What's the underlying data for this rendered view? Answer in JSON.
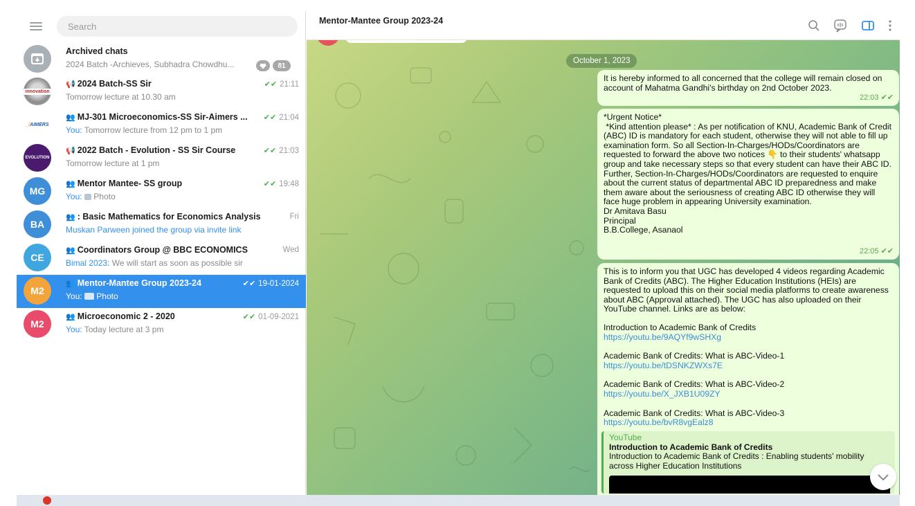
{
  "sidebar": {
    "search_placeholder": "Search",
    "chats": [
      {
        "title": "Archived chats",
        "subtitle": "2024 Batch -Archieves, Subhadra Chowdhu...",
        "badge": "81",
        "avatar_text": "",
        "avatar_color": "#a9b0b6"
      },
      {
        "title": "2024 Batch-SS Sir",
        "subtitle": "Tomorrow lecture at 10.30 am",
        "time": "21:11",
        "type_icon": "megaphone-icon"
      },
      {
        "title": "MJ-301 Microeconomics-SS Sir-Aimers ...",
        "sender": "You:",
        "subtitle": "Tomorrow lecture from 12 pm to 1 pm",
        "time": "21:04",
        "type_icon": "group-icon",
        "avatar_text": "AIMERS"
      },
      {
        "title": "2022 Batch - Evolution - SS Sir Course",
        "subtitle": "Tomorrow lecture at 1 pm",
        "time": "21:03",
        "type_icon": "megaphone-icon",
        "avatar_text": "EVOLUTION",
        "avatar_color": "#4a1a6e"
      },
      {
        "title": "Mentor Mantee- SS group",
        "sender": "You:",
        "subtitle": "Photo",
        "time": "19:48",
        "type_icon": "group-icon",
        "avatar_text": "MG",
        "avatar_color": "#3f8fd8"
      },
      {
        "title": ": Basic Mathematics for Economics Analysis",
        "subtitle": "Muskan Parween joined the group via invite link",
        "time": "Fri",
        "type_icon": "group-icon",
        "avatar_text": "BA",
        "avatar_color": "#3f8fd8"
      },
      {
        "title": "Coordinators Group @ BBC ECONOMICS",
        "sender": "Bimal 2023:",
        "subtitle": "We will start as soon as possible sir",
        "time": "Wed",
        "type_icon": "group-icon",
        "avatar_text": "CE",
        "avatar_color": "#3fa6df"
      },
      {
        "title": "Mentor-Mantee Group 2023-24",
        "sender": "You:",
        "subtitle": "Photo",
        "time": "19-01-2024",
        "type_icon": "group-icon",
        "avatar_text": "M2",
        "avatar_color": "#f3a43b",
        "active": true
      },
      {
        "title": "Microeconomic 2 - 2020",
        "sender": "You:",
        "subtitle": "Today lecture at 3 pm",
        "time": "01-09-2021",
        "type_icon": "group-icon",
        "avatar_text": "M2",
        "avatar_color": "#e94c6a"
      }
    ]
  },
  "chat": {
    "title": "Mentor-Mantee Group 2023-24",
    "date_pill": "October 1, 2023",
    "messages": [
      {
        "text": "It is hereby informed to all concerned that the college will remain closed on account of Mahatma Gandhi's birthday on 2nd October 2023.",
        "time": "22:03"
      },
      {
        "text": "*Urgent Notice*\n *Kind attention please* : As per notification of KNU, Academic Bank of Credit (ABC) ID is mandatory for each student, otherwise they will not able to fill up examination form. So all Section-In-Charges/HODs/Coordinators are requested to forward the above two notices 👇 to their students' whatsapp group and take necessary steps so that every student can have their ABC ID. Further, Section-In-Charges/HODs/Coordinators are requested to enquire about the current status of departmental ABC ID preparedness and make them aware about the seriousness of creating ABC ID otherwise they will face huge problem in appearing University examination.\nDr Amitava Basu\nPrincipal\nB.B.College, Asanaol",
        "time": "22:05"
      },
      {
        "intro": "This is to inform you that UGC has developed 4 videos regarding Academic Bank of Credits (ABC). The Higher Education Institutions (HEIs) are requested to upload this on their social media platforms to create awareness about ABC (Approval attached). The UGC has also uploaded on their YouTube channel. Links are as below:",
        "links": [
          {
            "label": "Introduction to Academic Bank of Credits",
            "url": "https://youtu.be/9AQYf9wSHXg"
          },
          {
            "label": "Academic Bank of Credits: What is ABC-Video-1",
            "url": "https://youtu.be/tDSNKZWXs7E"
          },
          {
            "label": "Academic Bank of Credits: What is ABC-Video-2",
            "url": "https://youtu.be/X_JXB1U09ZY"
          },
          {
            "label": "Academic Bank of Credits: What is ABC-Video-3",
            "url": "https://youtu.be/bvR8vgEalz8"
          }
        ],
        "preview": {
          "source": "YouTube",
          "title": "Introduction to Academic Bank of Credits",
          "description": "Introduction to Academic Bank of Credits : Enabling students' mobility across Higher Education Institutions"
        }
      }
    ]
  },
  "colors": {
    "accent": "#3390ec",
    "bubble": "#eeffde",
    "check": "#4fae4e"
  }
}
